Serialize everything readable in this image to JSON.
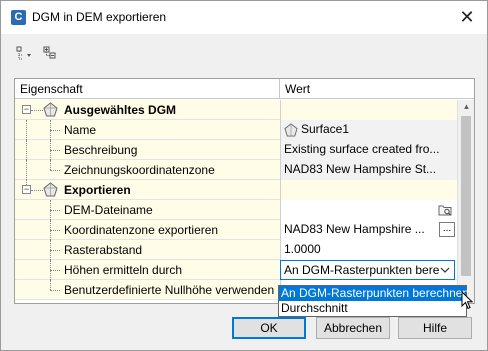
{
  "window": {
    "title": "DGM in DEM exportieren",
    "close_glyph": "✕"
  },
  "grid": {
    "header": {
      "property": "Eigenschaft",
      "value": "Wert"
    },
    "groups": [
      {
        "label": "Ausgewähltes DGM",
        "rows": [
          {
            "name": "Name",
            "value": "Surface1"
          },
          {
            "name": "Beschreibung",
            "value": "Existing surface created fro..."
          },
          {
            "name": "Zeichnungskoordinatenzone",
            "value": "NAD83 New Hampshire St..."
          }
        ]
      },
      {
        "label": "Exportieren",
        "rows": [
          {
            "name": "DEM-Dateiname",
            "value": ""
          },
          {
            "name": "Koordinatenzone exportieren",
            "value": "NAD83 New Hampshire ...",
            "button": "..."
          },
          {
            "name": "Rasterabstand",
            "value": "1.0000"
          },
          {
            "name": "Höhen ermitteln durch",
            "value": "An DGM-Rasterpunkten bere"
          },
          {
            "name": "Benutzerdefinierte Nullhöhe verwenden",
            "value": ""
          }
        ]
      }
    ]
  },
  "dropdown": {
    "options": [
      "An DGM-Rasterpunkten berechnen",
      "Durchschnitt"
    ],
    "selected_index": 0
  },
  "buttons": {
    "ok": "OK",
    "cancel": "Abbrechen",
    "help": "Hilfe"
  },
  "colors": {
    "accent": "#0078d7",
    "row_background": "#fffde8"
  }
}
